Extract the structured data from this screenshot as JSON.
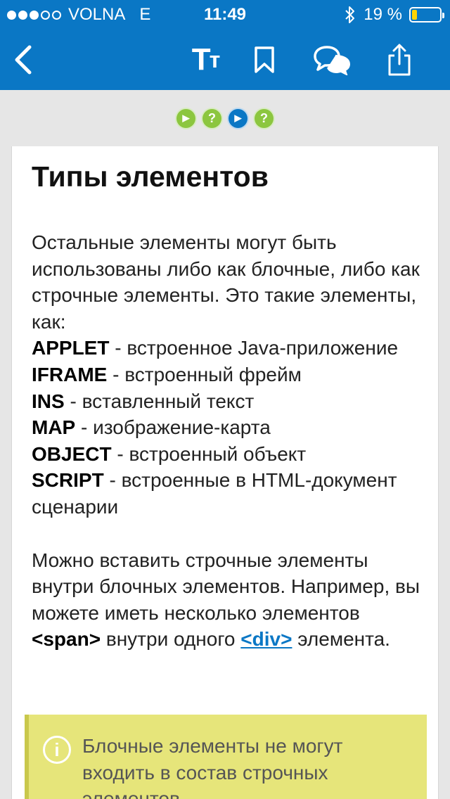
{
  "status_bar": {
    "carrier": "VOLNA",
    "network": "E",
    "time": "11:49",
    "battery_percent": "19 %",
    "battery_level": 0.19
  },
  "nav_bar": {
    "font_button_large": "T",
    "font_button_small": "т"
  },
  "progress": {
    "steps": [
      {
        "state": "done",
        "glyph": "▶"
      },
      {
        "state": "quiz",
        "glyph": "?"
      },
      {
        "state": "current",
        "glyph": "▶"
      },
      {
        "state": "quiz",
        "glyph": "?"
      }
    ]
  },
  "article": {
    "title": "Типы элементов",
    "intro": "Остальные элементы могут быть использованы либо как блочные, либо как строчные элементы. Это такие элементы, как:",
    "items": [
      {
        "term": "APPLET",
        "desc": " - встроенное Java-приложение"
      },
      {
        "term": "IFRAME",
        "desc": " - встроенный фрейм"
      },
      {
        "term": "INS",
        "desc": " - вставленный текст"
      },
      {
        "term": "MAP",
        "desc": " - изображение-карта"
      },
      {
        "term": "OBJECT",
        "desc": " - встроенный объект"
      },
      {
        "term": "SCRIPT",
        "desc": " - встроенные в HTML-документ сценарии"
      }
    ],
    "para2_before": "Можно вставить строчные элементы внутри блочных элементов. Например, вы можете иметь несколько элементов ",
    "para2_span": "<span>",
    "para2_middle": " внутри одного ",
    "para2_link": "<div>",
    "para2_after": " элемента.",
    "note_icon": "i",
    "note_text": "Блочные элементы не могут входить в состав строчных элементов."
  },
  "colors": {
    "brand_blue": "#0a77c5",
    "step_green": "#8cc63f",
    "note_yellow": "#e6e57a"
  },
  "icons": [
    "back-chevron-icon",
    "bookmark-icon",
    "comments-icon",
    "share-icon",
    "bluetooth-icon",
    "battery-icon",
    "info-icon"
  ]
}
